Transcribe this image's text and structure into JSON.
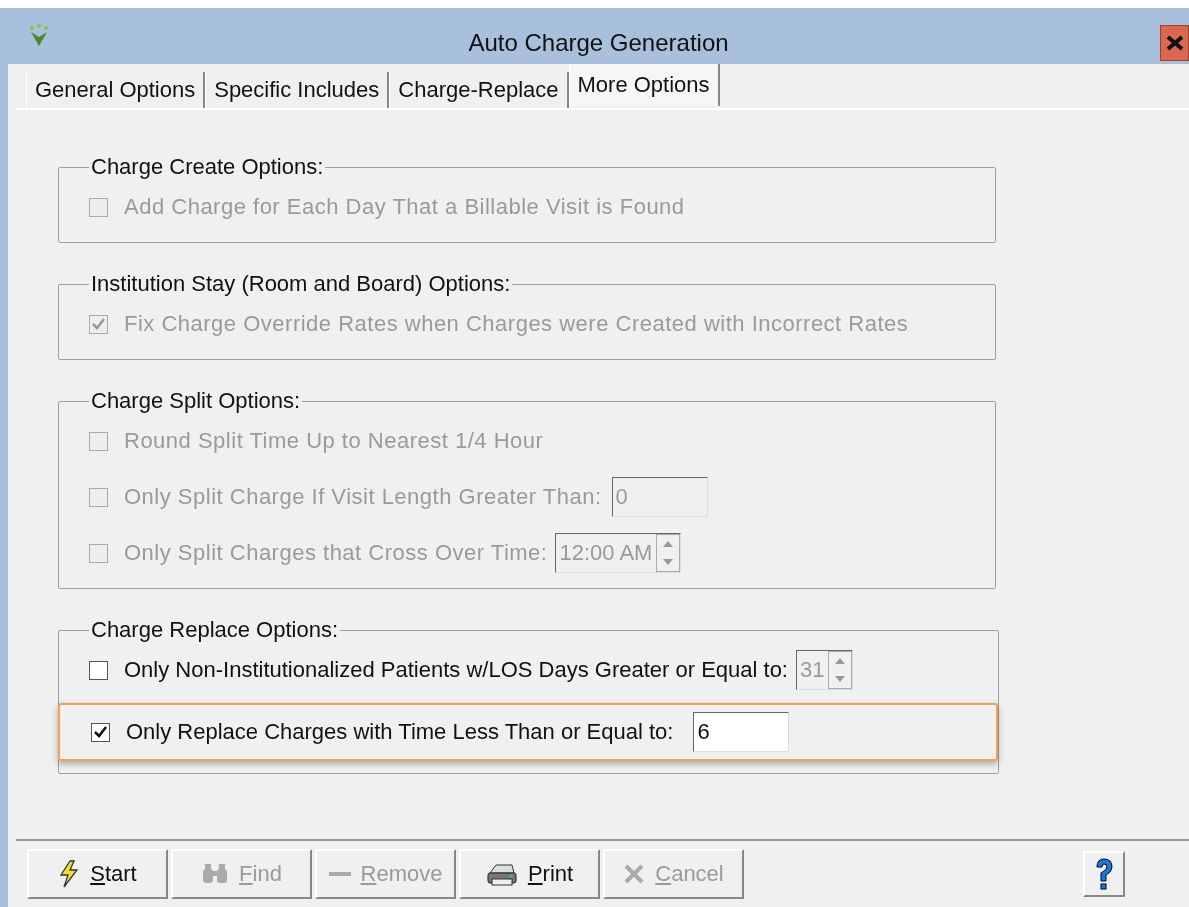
{
  "window": {
    "title": "Auto Charge Generation"
  },
  "tabs": [
    {
      "label": "General Options",
      "selected": false
    },
    {
      "label": "Specific Includes",
      "selected": false
    },
    {
      "label": "Charge-Replace",
      "selected": false
    },
    {
      "label": "More Options",
      "selected": true
    }
  ],
  "groups": [
    {
      "title": "Charge Create Options:",
      "options": [
        {
          "kind": "checkbox",
          "label": "Add Charge for Each Day That a Billable Visit is Found",
          "checked": false,
          "disabled": true,
          "highlighted": false
        }
      ]
    },
    {
      "title": "Institution Stay (Room and Board) Options:",
      "options": [
        {
          "kind": "checkbox",
          "label": "Fix Charge Override Rates when Charges were Created with Incorrect Rates",
          "checked": true,
          "disabled": true,
          "highlighted": false
        }
      ]
    },
    {
      "title": "Charge Split Options:",
      "options": [
        {
          "kind": "checkbox",
          "label": "Round Split Time Up to Nearest 1/4 Hour",
          "checked": false,
          "disabled": true,
          "highlighted": false
        },
        {
          "kind": "field",
          "label": "Only Split Charge If Visit Length Greater Than:",
          "checked": false,
          "disabled": true,
          "highlighted": false,
          "value": "0"
        },
        {
          "kind": "spinner",
          "label": "Only Split Charges that Cross Over Time:",
          "checked": false,
          "disabled": true,
          "highlighted": false,
          "value": "12:00 AM"
        }
      ]
    },
    {
      "title": "Charge Replace Options:",
      "options": [
        {
          "kind": "spinner",
          "label": "Only Non-Institutionalized Patients w/LOS Days Greater or Equal to:",
          "checked": false,
          "disabled": false,
          "field_disabled": true,
          "highlighted": false,
          "value": "31"
        },
        {
          "kind": "field",
          "label": "Only Replace Charges with Time Less Than or Equal to:",
          "checked": true,
          "disabled": false,
          "field_disabled": false,
          "highlighted": true,
          "value": "6"
        }
      ]
    }
  ],
  "buttons": [
    {
      "kind": "start",
      "label": "Start",
      "disabled": false
    },
    {
      "kind": "find",
      "label": "Find",
      "disabled": true
    },
    {
      "kind": "remove",
      "label": "Remove",
      "disabled": true
    },
    {
      "kind": "print",
      "label": "Print",
      "disabled": false
    },
    {
      "kind": "cancel",
      "label": "Cancel",
      "disabled": true
    }
  ]
}
